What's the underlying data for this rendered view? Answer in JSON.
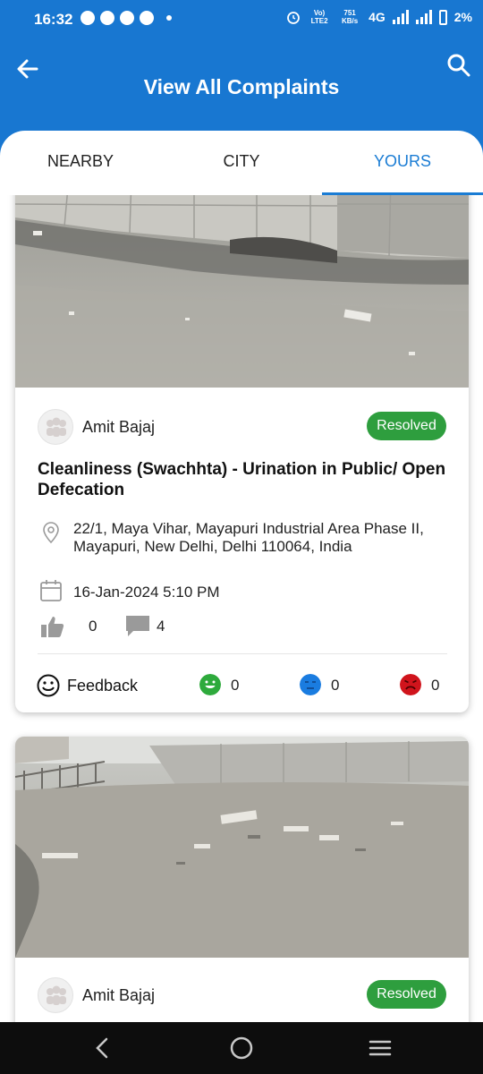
{
  "status_bar": {
    "time": "16:32",
    "network_small_1": "Vo) LTE2",
    "network_speed": "751 KB/s",
    "network_type": "4G",
    "battery": "2%"
  },
  "header": {
    "title": "View All Complaints",
    "back_icon": "arrow-left-icon",
    "search_icon": "search-icon"
  },
  "tabs": [
    {
      "label": "NEARBY",
      "active": false
    },
    {
      "label": "CITY",
      "active": false
    },
    {
      "label": "YOURS",
      "active": true
    }
  ],
  "complaints": [
    {
      "author": "Amit Bajaj",
      "status": "Resolved",
      "title": "Cleanliness (Swachhta) - Urination in Public/ Open Defecation",
      "address": "22/1, Maya Vihar, Mayapuri Industrial Area Phase II, Mayapuri, New Delhi, Delhi 110064, India",
      "date": "16-Jan-2024 5:10 PM",
      "likes": "0",
      "comments": "4",
      "feedback_label": "Feedback",
      "feedback_happy": "0",
      "feedback_neutral": "0",
      "feedback_angry": "0"
    },
    {
      "author": "Amit Bajaj",
      "status": "Resolved"
    }
  ],
  "colors": {
    "brand_blue": "#1877d1",
    "active_tab": "#1a7cd4",
    "resolved_green": "#2e9e3e",
    "happy_green": "#2eaa3c",
    "neutral_blue": "#1a7ce0",
    "angry_red": "#d0141c"
  },
  "nav": {
    "back": "nav-back-icon",
    "home": "nav-home-icon",
    "menu": "nav-menu-icon"
  }
}
